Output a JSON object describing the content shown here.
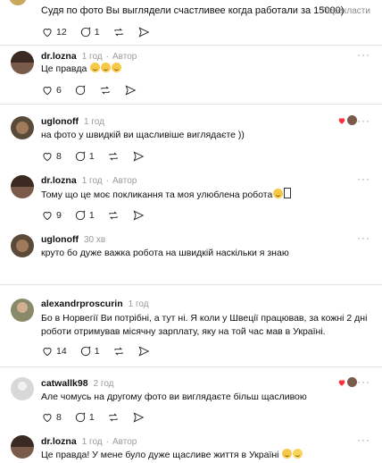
{
  "top": {
    "text": "Судя по фото Вы выглядели счастливее когда работали за 15000)",
    "translate": "Перекласти",
    "likes": "12",
    "replies": "1"
  },
  "comments": [
    {
      "user": "dr.lozna",
      "time": "1 год",
      "author": "Автор",
      "text": "Це правда",
      "likes": "6",
      "replies": ""
    },
    {
      "user": "uglonoff",
      "time": "1 год",
      "author": "",
      "text": "на фото у швидкій ви щасливіше виглядаєте ))",
      "likes": "8",
      "replies": "1"
    },
    {
      "user": "dr.lozna",
      "time": "1 год",
      "author": "Автор",
      "text": "Тому що це моє покликання та моя улюблена робота",
      "likes": "9",
      "replies": "1"
    },
    {
      "user": "uglonoff",
      "time": "30 хв",
      "author": "",
      "text": "круто бо дуже важка робота на швидкій наскільки я знаю",
      "likes": "",
      "replies": ""
    },
    {
      "user": "alexandrproscurin",
      "time": "1 год",
      "author": "",
      "text1": "Бо в Норвегії Ви потрібні, а тут ні. Я коли у Швеції працював, за кожні 2 дні",
      "text2": "роботи отримував місячну зарплату, яку на той час мав в Україні.",
      "likes": "14",
      "replies": "1"
    },
    {
      "user": "catwallk98",
      "time": "2 год",
      "author": "",
      "text": "Але чомусь на другому фото ви виглядаєте більш щасливою",
      "likes": "8",
      "replies": "1"
    },
    {
      "user": "dr.lozna",
      "time": "1 год",
      "author": "Автор",
      "text": "Це правда! У мене було дуже щасливе життя в Україні",
      "likes": "",
      "replies": ""
    }
  ],
  "more_label": "···",
  "colors": {
    "liked_heart": "#ff3040",
    "meta": "#9a9a9a"
  },
  "icons": [
    "heart-icon",
    "reply-icon",
    "repost-icon",
    "share-icon",
    "more-icon"
  ]
}
